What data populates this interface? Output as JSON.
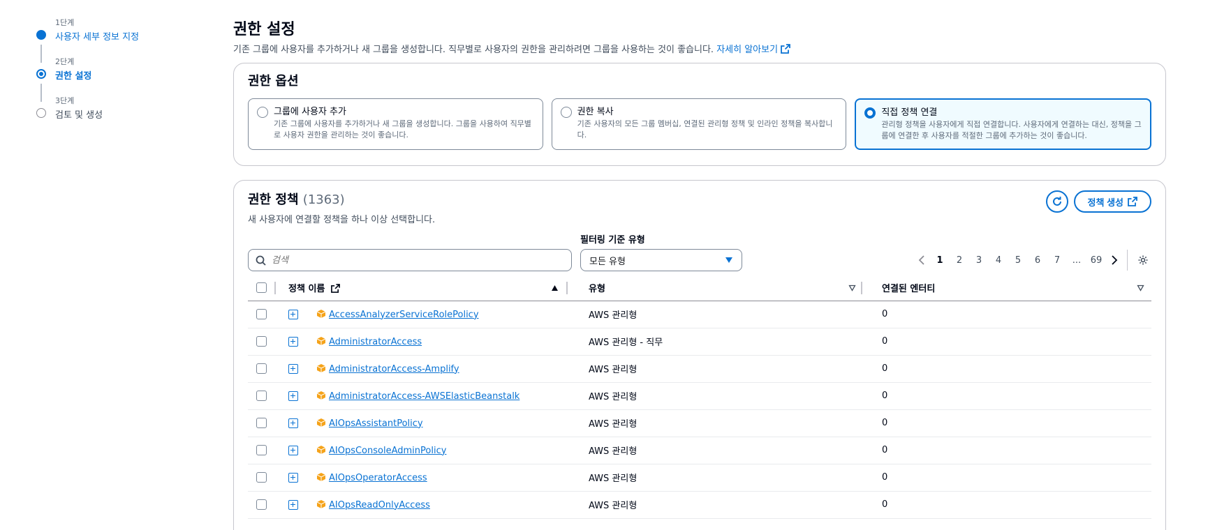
{
  "stepper": {
    "steps": [
      {
        "num": "1단계",
        "label": "사용자 세부 정보 지정"
      },
      {
        "num": "2단계",
        "label": "권한 설정"
      },
      {
        "num": "3단계",
        "label": "검토 및 생성"
      }
    ]
  },
  "header": {
    "title": "권한 설정",
    "description": "기존 그룹에 사용자를 추가하거나 새 그룹을 생성합니다. 직무별로 사용자의 권한을 관리하려면 그룹을 사용하는 것이 좋습니다.",
    "learn_more": "자세히 알아보기"
  },
  "options": {
    "title": "권한 옵션",
    "items": [
      {
        "label": "그룹에 사용자 추가",
        "desc": "기존 그룹에 사용자를 추가하거나 새 그룹을 생성합니다. 그룹을 사용하여 직무별로 사용자 권한을 관리하는 것이 좋습니다."
      },
      {
        "label": "권한 복사",
        "desc": "기존 사용자의 모든 그룹 멤버십, 연결된 관리형 정책 및 인라인 정책을 복사합니다."
      },
      {
        "label": "직접 정책 연결",
        "desc": "관리형 정책을 사용자에게 직접 연결합니다. 사용자에게 연결하는 대신, 정책을 그룹에 연결한 후 사용자를 적절한 그룹에 추가하는 것이 좋습니다."
      }
    ],
    "selected_index": 2
  },
  "policies": {
    "title": "권한 정책",
    "count": "(1363)",
    "subtitle": "새 사용자에 연결할 정책을 하나 이상 선택합니다.",
    "create_button": "정책 생성",
    "search_placeholder": "검색",
    "filter_label": "필터링 기준 유형",
    "filter_value": "모든 유형",
    "pagination": {
      "pages": [
        "1",
        "2",
        "3",
        "4",
        "5",
        "6",
        "7",
        "...",
        "69"
      ],
      "current": "1"
    },
    "columns": {
      "name": "정책 이름",
      "type": "유형",
      "entities": "연결된 엔터티"
    },
    "rows": [
      {
        "name": "AccessAnalyzerServiceRolePolicy",
        "type": "AWS 관리형",
        "entities": "0"
      },
      {
        "name": "AdministratorAccess",
        "type": "AWS 관리형 - 직무",
        "entities": "0"
      },
      {
        "name": "AdministratorAccess-Amplify",
        "type": "AWS 관리형",
        "entities": "0"
      },
      {
        "name": "AdministratorAccess-AWSElasticBeanstalk",
        "type": "AWS 관리형",
        "entities": "0"
      },
      {
        "name": "AIOpsAssistantPolicy",
        "type": "AWS 관리형",
        "entities": "0"
      },
      {
        "name": "AIOpsConsoleAdminPolicy",
        "type": "AWS 관리형",
        "entities": "0"
      },
      {
        "name": "AIOpsOperatorAccess",
        "type": "AWS 관리형",
        "entities": "0"
      },
      {
        "name": "AIOpsReadOnlyAccess",
        "type": "AWS 관리형",
        "entities": "0"
      }
    ]
  },
  "icons": {
    "step_dot": "circle",
    "external_link": "external-link-icon",
    "refresh": "refresh-icon",
    "search": "search-icon",
    "dropdown": "caret-down-icon",
    "settings": "gear-icon",
    "package": "package-icon"
  },
  "colors": {
    "accent": "#0972d3",
    "selected_bg": "#f0fbff",
    "package_icon": "#f5a31a",
    "text_primary": "#000716",
    "text_secondary": "#5f6b7a"
  }
}
